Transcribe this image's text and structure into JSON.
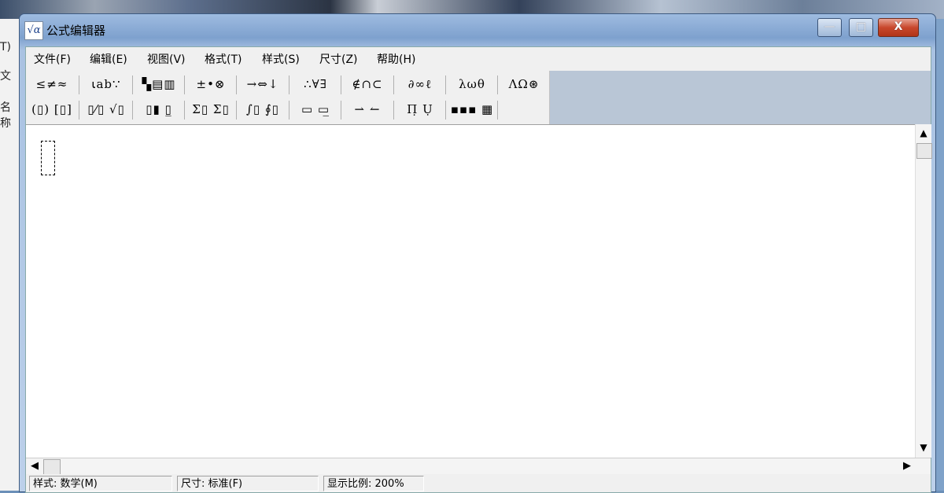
{
  "window": {
    "title": "公式编辑器",
    "minimize": "—",
    "maximize": "□",
    "close": "X",
    "app_icon": "√α"
  },
  "menu": [
    {
      "label": "文件(F)"
    },
    {
      "label": "编辑(E)"
    },
    {
      "label": "视图(V)"
    },
    {
      "label": "格式(T)"
    },
    {
      "label": "样式(S)"
    },
    {
      "label": "尺寸(Z)"
    },
    {
      "label": "帮助(H)"
    }
  ],
  "toolbar": {
    "row1": [
      {
        "label": "≤≠≈",
        "icon": "relations-palette"
      },
      {
        "label": "⍳ab∵",
        "icon": "spaces-ellipses-palette"
      },
      {
        "label": "▚▤▥",
        "icon": "embellishments-palette"
      },
      {
        "label": "±•⊗",
        "icon": "operators-palette"
      },
      {
        "label": "→⇔↓",
        "icon": "arrows-palette"
      },
      {
        "label": "∴∀∃",
        "icon": "logic-palette"
      },
      {
        "label": "∉∩⊂",
        "icon": "set-theory-palette"
      },
      {
        "label": "∂∞ℓ",
        "icon": "misc-symbols-palette"
      },
      {
        "label": "λωθ",
        "icon": "greek-lowercase-palette"
      },
      {
        "label": "ΛΩ⊛",
        "icon": "greek-uppercase-palette"
      }
    ],
    "row2": [
      {
        "label": "(▯) [▯]",
        "icon": "fences-template"
      },
      {
        "label": "▯⁄▯ √▯",
        "icon": "fraction-radical-template"
      },
      {
        "label": "▯▮ ▯̲",
        "icon": "subscript-superscript-template"
      },
      {
        "label": "Σ▯ Σ▯",
        "icon": "summation-template"
      },
      {
        "label": "∫▯ ∮▯",
        "icon": "integral-template"
      },
      {
        "label": "▭ ▭̲",
        "icon": "underbar-overbar-template"
      },
      {
        "label": "⇀ ↼",
        "icon": "labeled-arrow-template"
      },
      {
        "label": "Π̣ Ụ",
        "icon": "product-set-template"
      },
      {
        "label": "▪▪▪ ▦",
        "icon": "matrix-template"
      }
    ]
  },
  "status": {
    "style": "样式: 数学(M)",
    "size": "尺寸: 标准(F)",
    "zoom": "显示比例: 200%"
  },
  "background": {
    "left_fragments": [
      "T)",
      "文",
      "名称"
    ]
  }
}
